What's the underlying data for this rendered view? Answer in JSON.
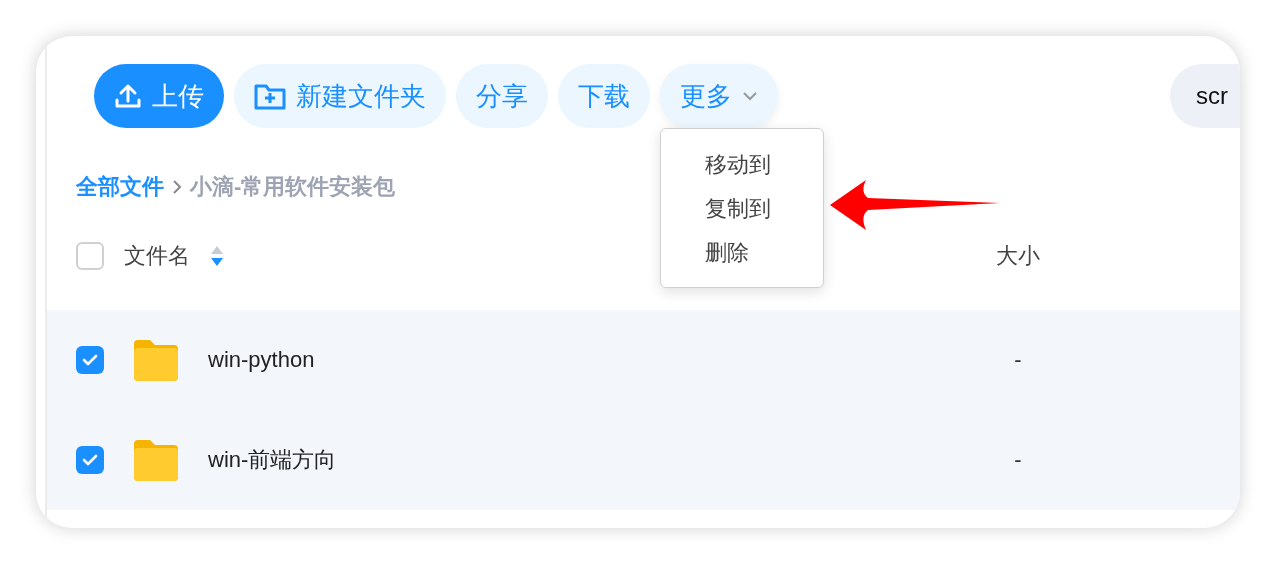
{
  "toolbar": {
    "buttons": [
      {
        "kind": "upload",
        "label": "上传"
      },
      {
        "kind": "new-folder",
        "label": "新建文件夹"
      },
      {
        "kind": "plain",
        "label": "分享"
      },
      {
        "kind": "plain",
        "label": "下载"
      },
      {
        "kind": "more",
        "label": "更多",
        "expanded": true
      }
    ],
    "menu": [
      {
        "label": "移动到"
      },
      {
        "label": "复制到"
      },
      {
        "label": "删除"
      }
    ],
    "search": {
      "value": "scr"
    }
  },
  "breadcrumb": [
    {
      "label": "全部文件",
      "current": false
    },
    {
      "label": "小滴-常用软件安装包",
      "current": true
    }
  ],
  "table": {
    "select_all": {
      "checked": false
    },
    "columns": [
      {
        "label": "文件名",
        "sorted_descending": true
      },
      {
        "label": "大小"
      }
    ],
    "rows": [
      {
        "name": "win-python",
        "size": "-",
        "selected": true
      },
      {
        "name": "win-前端方向",
        "size": "-",
        "selected": true
      }
    ]
  }
}
